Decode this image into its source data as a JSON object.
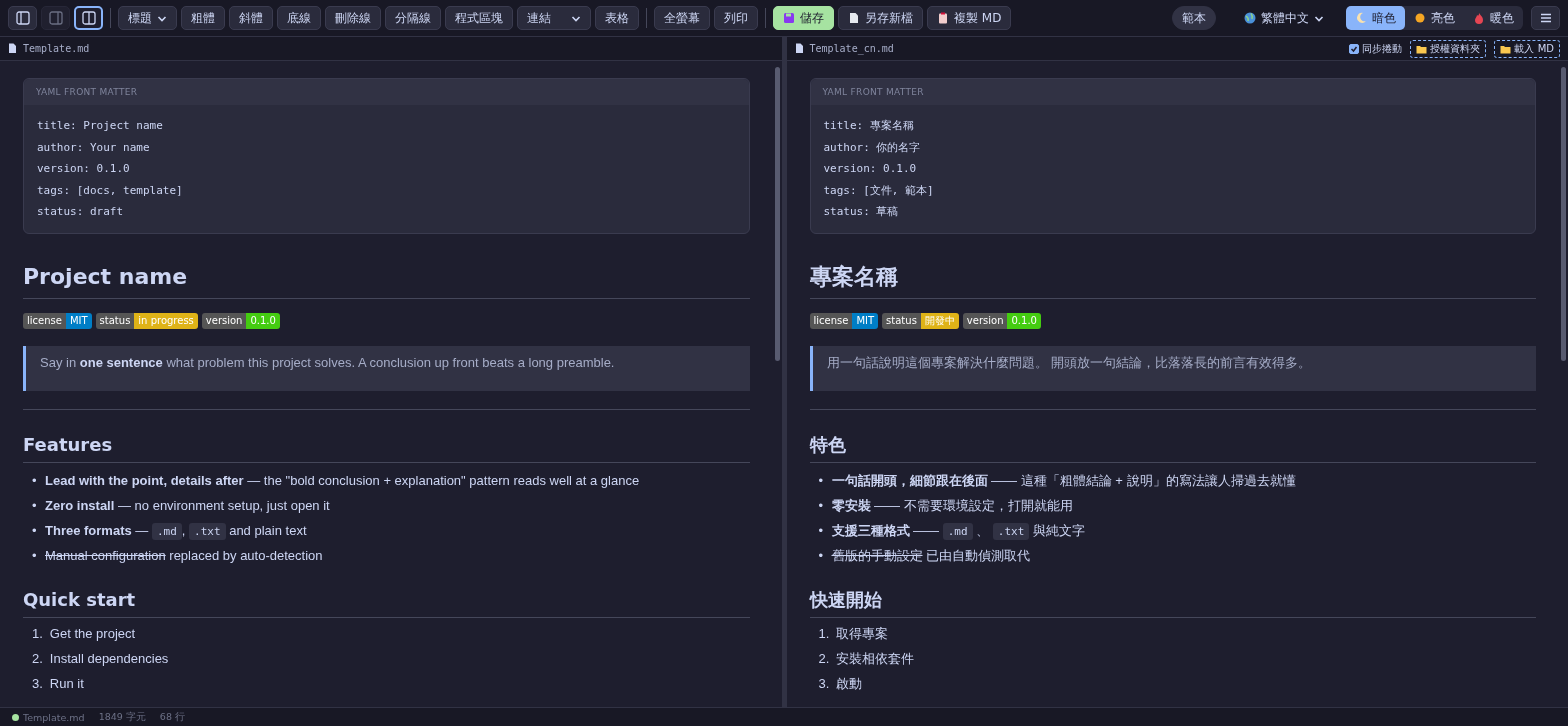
{
  "toolbar": {
    "layouts": [
      {
        "kind": "editor",
        "selected": false,
        "disabled": false
      },
      {
        "kind": "preview",
        "selected": false,
        "disabled": true
      },
      {
        "kind": "split",
        "selected": true,
        "disabled": false
      }
    ],
    "groups": [
      [
        {
          "kind": "select",
          "label": "標題"
        },
        {
          "kind": "button",
          "label": "粗體"
        },
        {
          "kind": "button",
          "label": "斜體"
        },
        {
          "kind": "button",
          "label": "底線"
        },
        {
          "kind": "button",
          "label": "刪除線"
        },
        {
          "kind": "button",
          "label": "分隔線"
        },
        {
          "kind": "button",
          "label": "程式區塊"
        },
        {
          "kind": "select",
          "label": "連結"
        },
        {
          "kind": "button",
          "label": "表格"
        }
      ],
      [
        {
          "kind": "button",
          "label": "全螢幕"
        },
        {
          "kind": "button",
          "label": "列印"
        }
      ],
      [
        {
          "kind": "save",
          "label": "儲存"
        },
        {
          "kind": "file",
          "label": "另存新檔"
        },
        {
          "kind": "copy",
          "label": "複製 MD"
        }
      ]
    ],
    "template": "範本",
    "language": "繁體中文",
    "themes": [
      {
        "kind": "moon",
        "label": "暗色",
        "selected": true
      },
      {
        "kind": "sun",
        "label": "亮色",
        "selected": false
      },
      {
        "kind": "fire",
        "label": "暖色",
        "selected": false
      }
    ]
  },
  "panes": [
    {
      "file": "Template.md",
      "blocks": [
        {
          "kind": "yaml",
          "title": "YAML FRONT MATTER",
          "lines": [
            "title: Project name",
            "author: Your name",
            "version: 0.1.0",
            "tags: [docs, template]",
            "status: draft"
          ]
        },
        {
          "kind": "h1",
          "text": "Project name"
        },
        {
          "kind": "badges",
          "items": [
            {
              "label": "license",
              "value": "MIT",
              "color": "#007ec6"
            },
            {
              "label": "status",
              "value": "in progress",
              "color": "#dfb317"
            },
            {
              "label": "version",
              "value": "0.1.0",
              "color": "#4c1"
            }
          ]
        },
        {
          "kind": "quote",
          "text": "Say in **one sentence** what problem this project solves. A conclusion up front beats a long preamble."
        },
        {
          "kind": "rule"
        },
        {
          "kind": "h2",
          "text": "Features"
        },
        {
          "kind": "ul",
          "items": [
            {
              "marker": "•",
              "parts": [
                {
                  "kind": "bold",
                  "text": "Lead with the point, details after"
                },
                {
                  "kind": "plain",
                  "text": " — the \"bold conclusion + explanation\" pattern reads well at a glance"
                }
              ]
            },
            {
              "marker": "•",
              "parts": [
                {
                  "kind": "bold",
                  "text": "Zero install"
                },
                {
                  "kind": "plain",
                  "text": " — no environment setup, just open it"
                }
              ]
            },
            {
              "marker": "•",
              "parts": [
                {
                  "kind": "bold",
                  "text": "Three formats"
                },
                {
                  "kind": "plain",
                  "text": " — "
                },
                {
                  "kind": "code",
                  "text": ".md"
                },
                {
                  "kind": "plain",
                  "text": ", "
                },
                {
                  "kind": "code",
                  "text": ".txt"
                },
                {
                  "kind": "plain",
                  "text": " and plain text"
                }
              ]
            },
            {
              "marker": "•",
              "parts": [
                {
                  "kind": "strike",
                  "text": "Manual configuration"
                },
                {
                  "kind": "plain",
                  "text": " replaced by auto-detection"
                }
              ]
            }
          ]
        },
        {
          "kind": "h2",
          "text": "Quick start"
        },
        {
          "kind": "ol",
          "items": [
            {
              "marker": "1.",
              "parts": [
                {
                  "kind": "plain",
                  "text": "Get the project"
                }
              ]
            },
            {
              "marker": "2.",
              "parts": [
                {
                  "kind": "plain",
                  "text": "Install dependencies"
                }
              ]
            },
            {
              "marker": "3.",
              "parts": [
                {
                  "kind": "plain",
                  "text": "Run it"
                }
              ]
            }
          ]
        }
      ]
    },
    {
      "file": "Template_cn.md",
      "sync": {
        "label": "同步捲動",
        "checked": true
      },
      "actions": [
        "授權資料夾",
        "載入 MD"
      ],
      "blocks": [
        {
          "kind": "yaml",
          "title": "YAML FRONT MATTER",
          "lines": [
            "title: 專案名稱",
            "author: 你的名字",
            "version: 0.1.0",
            "tags: [文件, 範本]",
            "status: 草稿"
          ]
        },
        {
          "kind": "h1",
          "text": "專案名稱"
        },
        {
          "kind": "badges",
          "items": [
            {
              "label": "license",
              "value": "MIT",
              "color": "#007ec6"
            },
            {
              "label": "status",
              "value": "開發中",
              "color": "#dfb317"
            },
            {
              "label": "version",
              "value": "0.1.0",
              "color": "#4c1"
            }
          ]
        },
        {
          "kind": "quote",
          "text": "用一句話說明這個專案解決什麼問題。 開頭放一句結論，比落落長的前言有效得多。"
        },
        {
          "kind": "rule"
        },
        {
          "kind": "h2",
          "text": "特色"
        },
        {
          "kind": "ul",
          "items": [
            {
              "marker": "•",
              "parts": [
                {
                  "kind": "bold",
                  "text": "一句話開頭，細節跟在後面"
                },
                {
                  "kind": "plain",
                  "text": " —— 這種「粗體結論 + 說明」的寫法讓人掃過去就懂"
                }
              ]
            },
            {
              "marker": "•",
              "parts": [
                {
                  "kind": "bold",
                  "text": "零安裝"
                },
                {
                  "kind": "plain",
                  "text": " —— 不需要環境設定，打開就能用"
                }
              ]
            },
            {
              "marker": "•",
              "parts": [
                {
                  "kind": "bold",
                  "text": "支援三種格式"
                },
                {
                  "kind": "plain",
                  "text": " —— "
                },
                {
                  "kind": "code",
                  "text": ".md"
                },
                {
                  "kind": "plain",
                  "text": " 、 "
                },
                {
                  "kind": "code",
                  "text": ".txt"
                },
                {
                  "kind": "plain",
                  "text": " 與純文字"
                }
              ]
            },
            {
              "marker": "•",
              "parts": [
                {
                  "kind": "strike",
                  "text": "舊版的手動設定"
                },
                {
                  "kind": "plain",
                  "text": " 已由自動偵測取代"
                }
              ]
            }
          ]
        },
        {
          "kind": "h2",
          "text": "快速開始"
        },
        {
          "kind": "ol",
          "items": [
            {
              "marker": "1.",
              "parts": [
                {
                  "kind": "plain",
                  "text": "取得專案"
                }
              ]
            },
            {
              "marker": "2.",
              "parts": [
                {
                  "kind": "plain",
                  "text": "安裝相依套件"
                }
              ]
            },
            {
              "marker": "3.",
              "parts": [
                {
                  "kind": "plain",
                  "text": "啟動"
                }
              ]
            }
          ]
        }
      ]
    }
  ],
  "status_bar": {
    "file": "Template.md",
    "chars": "1849 字元",
    "lines": "68 行"
  }
}
